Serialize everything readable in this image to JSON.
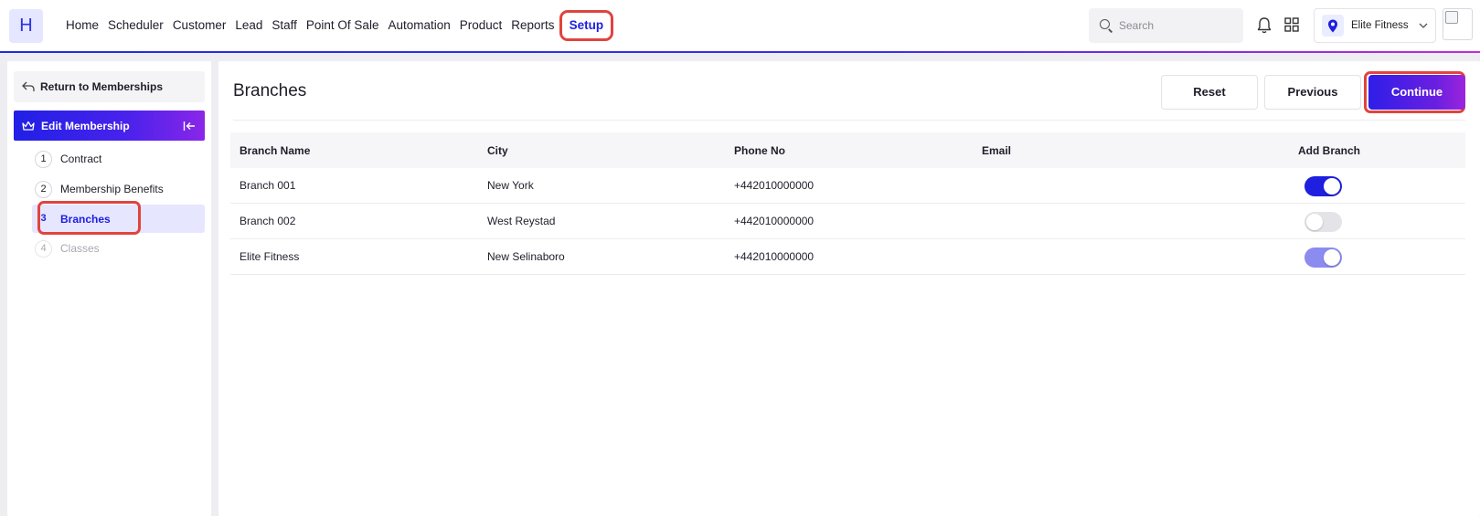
{
  "nav": {
    "logo_letter": "H",
    "items": [
      "Home",
      "Scheduler",
      "Customer",
      "Lead",
      "Staff",
      "Point Of Sale",
      "Automation",
      "Product",
      "Reports"
    ],
    "active_item": "Setup",
    "search_placeholder": "Search",
    "location": "Elite Fitness"
  },
  "sidebar": {
    "return_label": "Return to Memberships",
    "edit_label": "Edit Membership",
    "steps": [
      {
        "num": "1",
        "label": "Contract"
      },
      {
        "num": "2",
        "label": "Membership Benefits"
      },
      {
        "num": "3",
        "label": "Branches"
      },
      {
        "num": "4",
        "label": "Classes"
      }
    ]
  },
  "main": {
    "title": "Branches",
    "buttons": {
      "reset": "Reset",
      "previous": "Previous",
      "continue": "Continue"
    },
    "columns": [
      "Branch Name",
      "City",
      "Phone No",
      "Email",
      "Add Branch"
    ],
    "rows": [
      {
        "name": "Branch 001",
        "city": "New York",
        "phone": "+442010000000",
        "email": "",
        "add_branch": "on"
      },
      {
        "name": "Branch 002",
        "city": "West Reystad",
        "phone": "+442010000000",
        "email": "",
        "add_branch": "off"
      },
      {
        "name": "Elite Fitness",
        "city": "New Selinaboro",
        "phone": "+442010000000",
        "email": "",
        "add_branch": "on-disabled"
      }
    ]
  },
  "colors": {
    "primary": "#1f1fe0",
    "highlight": "#e0443e",
    "active_step_bg": "#e7e6ff"
  }
}
